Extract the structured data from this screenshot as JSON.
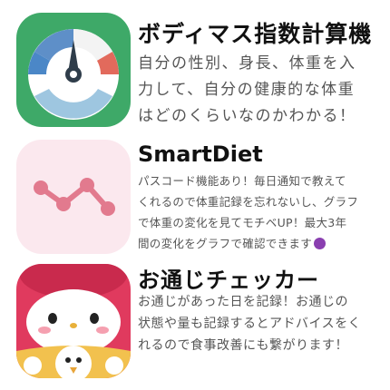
{
  "apps": [
    {
      "name": "ボディマス指数計算機",
      "description": "自分の性別、身長、体重を入\n力して、自分の健康的な体重\nはどのくらいなのかわかる！",
      "icon": "bmi-gauge-icon"
    },
    {
      "name": "SmartDiet",
      "description": "パスコード機能あり！毎日通知で教えて\nくれるので体重記録を忘れないし、グラフ\nで体重の変化を見てモチベUP！最大3年\n間の変化をグラフで確認できます",
      "icon": "weight-graph-icon"
    },
    {
      "name": "お通じチェッカー",
      "description": "お通じがあった日を記録！お通じの\n状態や量も記録するとアドバイスをく\nれるので食事改善にも繋がります！",
      "icon": "character-icon"
    }
  ],
  "colors": {
    "bmi_bg": "#3ea968",
    "smartdiet_bg": "#fbe8ee",
    "smartdiet_line": "#e27a8e",
    "checker_bg": "#e03a5e"
  }
}
